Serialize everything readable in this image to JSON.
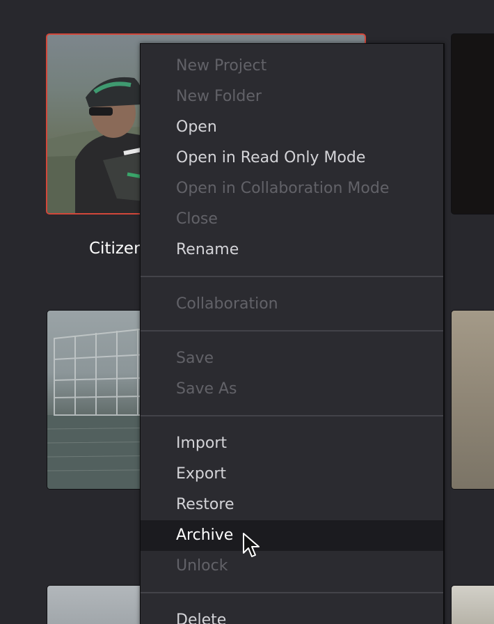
{
  "project_grid": {
    "selected_project_name": "Citizen"
  },
  "context_menu": {
    "items": [
      {
        "label": "New Project",
        "enabled": false
      },
      {
        "label": "New Folder",
        "enabled": false
      },
      {
        "label": "Open",
        "enabled": true
      },
      {
        "label": "Open in Read Only Mode",
        "enabled": true
      },
      {
        "label": "Open in Collaboration Mode",
        "enabled": false
      },
      {
        "label": "Close",
        "enabled": false
      },
      {
        "label": "Rename",
        "enabled": true
      },
      {
        "label": "Collaboration",
        "enabled": false
      },
      {
        "label": "Save",
        "enabled": false
      },
      {
        "label": "Save As",
        "enabled": false
      },
      {
        "label": "Import",
        "enabled": true
      },
      {
        "label": "Export",
        "enabled": true
      },
      {
        "label": "Restore",
        "enabled": true
      },
      {
        "label": "Archive",
        "enabled": true,
        "highlighted": true
      },
      {
        "label": "Unlock",
        "enabled": false
      },
      {
        "label": "Delete",
        "enabled": true
      }
    ]
  },
  "colors": {
    "background": "#28282d",
    "menu_background": "#2b2b30",
    "menu_highlight": "#1b1b1f",
    "selected_border": "#d2473a",
    "enabled_text": "#d4d4d8",
    "disabled_text": "#626268"
  },
  "icons": {
    "cursor": "arrow-pointer-icon"
  }
}
